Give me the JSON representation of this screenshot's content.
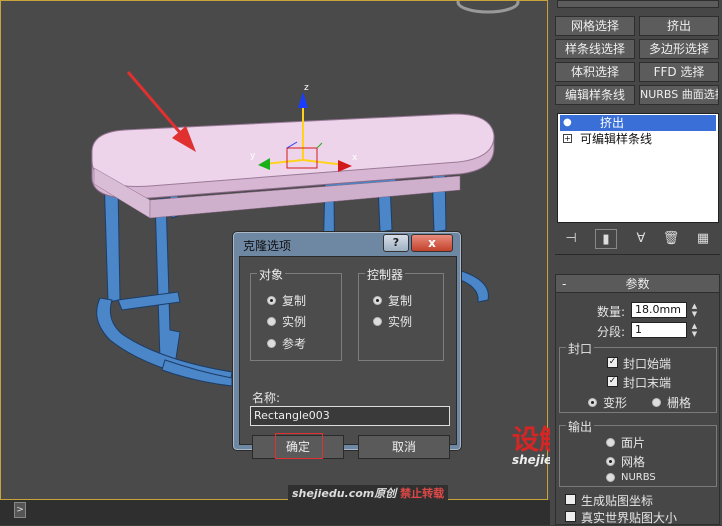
{
  "dialog": {
    "title": "克隆选项",
    "help_label": "?",
    "close_label": "x",
    "object_group": {
      "title": "对象",
      "options": [
        "复制",
        "实例",
        "参考"
      ],
      "selected": 0
    },
    "controller_group": {
      "title": "控制器",
      "options": [
        "复制",
        "实例"
      ],
      "selected": 0
    },
    "name_label": "名称:",
    "name_value": "Rectangle003",
    "ok_label": "确定",
    "cancel_label": "取消"
  },
  "viewport": {
    "gizmo": {
      "x_label": "x",
      "y_label": "y",
      "z_label": "z"
    }
  },
  "modifier_buttons": [
    {
      "label": "网格选择"
    },
    {
      "label": "挤出"
    },
    {
      "label": "样条线选择"
    },
    {
      "label": "多边形选择"
    },
    {
      "label": "体积选择"
    },
    {
      "label": "FFD 选择"
    },
    {
      "label": "编辑样条线"
    },
    {
      "label": "NURBS 曲面选择"
    }
  ],
  "modifier_stack": {
    "items": [
      {
        "label": "挤出",
        "selected": true
      },
      {
        "label": "可编辑样条线",
        "selected": false
      }
    ]
  },
  "toolbar": {
    "icons": [
      "pin-stack-icon",
      "show-end-result-icon",
      "make-unique-icon",
      "remove-modifier-icon",
      "configure-sets-icon"
    ],
    "glyphs": [
      "⊣",
      "▮",
      "∀",
      "🗑",
      "▦"
    ]
  },
  "parameters": {
    "title": "参数",
    "collapse_label": "-",
    "amount_label": "数量:",
    "amount_value": "18.0mm",
    "segments_label": "分段:",
    "segments_value": "1",
    "capping": {
      "title": "封口",
      "cap_start_label": "封口始端",
      "cap_start_checked": true,
      "cap_end_label": "封口末端",
      "cap_end_checked": true,
      "morph_label": "变形",
      "grid_label": "栅格",
      "selected": "morph"
    },
    "output": {
      "title": "输出",
      "patch_label": "面片",
      "mesh_label": "网格",
      "nurbs_label": "NURBS"
    },
    "gen_map_coords_label": "生成贴图坐标",
    "real_world_label": "真实世界贴图大小"
  },
  "watermark": {
    "logo": "设解读",
    "site": "shejiedu.com",
    "credit_site": "shejiedu.com原创",
    "credit_warning": "禁止转载"
  },
  "timeline": {
    "arrow_label": ">"
  },
  "colors": {
    "table_top": "#e8c8e4",
    "table_legs": "#4a86c8",
    "arrow": "#e03030",
    "dialog_frame": "#6e87a3",
    "selection_highlight": "#3a6fd8"
  }
}
